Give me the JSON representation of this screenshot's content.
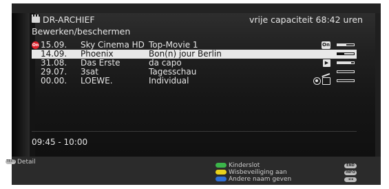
{
  "header": {
    "title": "DR-ARCHIEF",
    "subtitle": "Bewerken/beschermen",
    "capacity": "vrije capaciteit 68:42 uren"
  },
  "recordings": [
    {
      "date": "15.09.",
      "channel": "Sky Cinema HD",
      "title": "Top-Movie 1",
      "protected": true,
      "status_icon": "on-icon",
      "bar_fill": 0.55,
      "selected": false
    },
    {
      "date": "14.09.",
      "channel": "Phoenix",
      "title": "Bon(n) jour Berlin",
      "protected": false,
      "status_icon": "",
      "bar_fill": 0.4,
      "selected": true
    },
    {
      "date": "31.08.",
      "channel": "Das Erste",
      "title": "da capo",
      "protected": false,
      "status_icon": "play-icon",
      "bar_fill": 0.85,
      "selected": false
    },
    {
      "date": "29.07.",
      "channel": "3sat",
      "title": "Tagesschau",
      "protected": false,
      "status_icon": "",
      "bar_fill": 0.0,
      "selected": false
    },
    {
      "date": "00.00.",
      "channel": "LOEWE.",
      "title": "Individual",
      "protected": false,
      "status_icon": "lock-film-icons",
      "bar_fill": 0.0,
      "selected": false
    }
  ],
  "protect_badge": "On",
  "on_icon_label": "On",
  "time_range": "09:45 - 10:00",
  "footer": {
    "detail_key": "TEXT",
    "detail_label": "Detail",
    "legend": [
      {
        "label": "Kinderslot",
        "color": "#3bb54a"
      },
      {
        "label": "Wisbeveiliging aan",
        "color": "#e8d21c"
      },
      {
        "label": "Andere naam geven",
        "color": "#2f6fd6"
      }
    ],
    "keys": [
      "END",
      "INFO",
      "◄◄"
    ]
  }
}
